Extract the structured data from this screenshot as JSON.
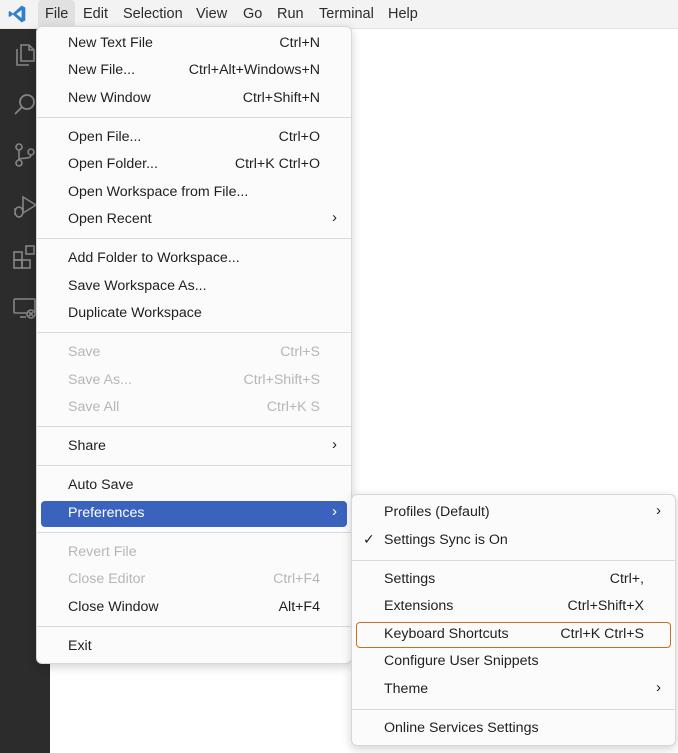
{
  "menubar": {
    "logo": "vscode-logo",
    "items": [
      "File",
      "Edit",
      "Selection",
      "View",
      "Go",
      "Run",
      "Terminal",
      "Help"
    ]
  },
  "activitybar": {
    "icons": [
      "explorer-icon",
      "search-icon",
      "source-control-icon",
      "run-debug-icon",
      "extensions-icon",
      "remote-explorer-icon"
    ]
  },
  "file_menu": {
    "groups": [
      [
        {
          "label": "New Text File",
          "accel": "Ctrl+N"
        },
        {
          "label": "New File...",
          "accel": "Ctrl+Alt+Windows+N"
        },
        {
          "label": "New Window",
          "accel": "Ctrl+Shift+N"
        }
      ],
      [
        {
          "label": "Open File...",
          "accel": "Ctrl+O"
        },
        {
          "label": "Open Folder...",
          "accel": "Ctrl+K Ctrl+O"
        },
        {
          "label": "Open Workspace from File...",
          "accel": ""
        },
        {
          "label": "Open Recent",
          "accel": "",
          "submenu": true
        }
      ],
      [
        {
          "label": "Add Folder to Workspace...",
          "accel": ""
        },
        {
          "label": "Save Workspace As...",
          "accel": ""
        },
        {
          "label": "Duplicate Workspace",
          "accel": ""
        }
      ],
      [
        {
          "label": "Save",
          "accel": "Ctrl+S",
          "disabled": true
        },
        {
          "label": "Save As...",
          "accel": "Ctrl+Shift+S",
          "disabled": true
        },
        {
          "label": "Save All",
          "accel": "Ctrl+K S",
          "disabled": true
        }
      ],
      [
        {
          "label": "Share",
          "accel": "",
          "submenu": true
        }
      ],
      [
        {
          "label": "Auto Save",
          "accel": ""
        },
        {
          "label": "Preferences",
          "accel": "",
          "submenu": true,
          "selected": true
        }
      ],
      [
        {
          "label": "Revert File",
          "accel": "",
          "disabled": true
        },
        {
          "label": "Close Editor",
          "accel": "Ctrl+F4",
          "disabled": true
        },
        {
          "label": "Close Window",
          "accel": "Alt+F4"
        }
      ],
      [
        {
          "label": "Exit",
          "accel": ""
        }
      ]
    ]
  },
  "preferences_menu": {
    "groups": [
      [
        {
          "label": "Profiles (Default)",
          "accel": "",
          "submenu": true
        },
        {
          "label": "Settings Sync is On",
          "accel": "",
          "checked": true
        }
      ],
      [
        {
          "label": "Settings",
          "accel": "Ctrl+,"
        },
        {
          "label": "Extensions",
          "accel": "Ctrl+Shift+X"
        },
        {
          "label": "Keyboard Shortcuts",
          "accel": "Ctrl+K Ctrl+S",
          "focused": true
        },
        {
          "label": "Configure User Snippets",
          "accel": ""
        },
        {
          "label": "Theme",
          "accel": "",
          "submenu": true
        }
      ],
      [
        {
          "label": "Online Services Settings",
          "accel": ""
        }
      ]
    ]
  },
  "colors": {
    "selected": "#3b63bd",
    "focus_outline": "#c8701d",
    "activitybar": "#2c2c2c",
    "disabled_text": "#b6b6b6"
  }
}
